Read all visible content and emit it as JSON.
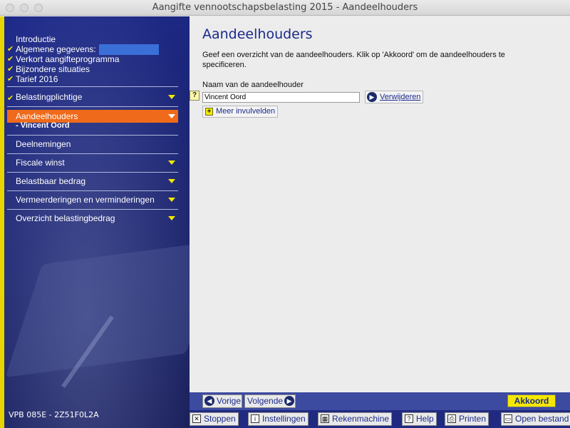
{
  "window": {
    "title": "Aangifte vennootschapsbelasting 2015 - Aandeelhouders"
  },
  "sidebar": {
    "intro_items": [
      {
        "label": "Introductie",
        "checked": false
      },
      {
        "label": "Algemene gegevens:",
        "checked": true
      },
      {
        "label": "Verkort aangifteprogramma",
        "checked": true
      },
      {
        "label": "Bijzondere situaties",
        "checked": true
      },
      {
        "label": "Tarief 2016",
        "checked": true
      }
    ],
    "items": [
      {
        "label": "Belastingplichtige",
        "checked": true
      },
      {
        "label": "Aandeelhouders",
        "active": true,
        "sub": "- Vincent Oord"
      },
      {
        "label": "Deelnemingen"
      },
      {
        "label": "Fiscale winst"
      },
      {
        "label": "Belastbaar bedrag"
      },
      {
        "label": "Vermeerderingen en verminderingen"
      },
      {
        "label": "Overzicht belastingbedrag"
      }
    ],
    "version": "VPB 085E - 2Z51F0L2A"
  },
  "main": {
    "title": "Aandeelhouders",
    "description": "Geef een overzicht van de aandeelhouders. Klik op 'Akkoord' om de aandeelhouders te specificeren.",
    "field_label": "Naam van de aandeelhouder",
    "field_value": "Vincent Oord",
    "help_label": "?",
    "remove_label": "Verwijderen",
    "more_label": "Meer invulvelden"
  },
  "navigation": {
    "prev_label": "Vorige",
    "next_label": "Volgende",
    "accept_label": "Akkoord"
  },
  "toolbar": {
    "stop_label": "Stoppen",
    "settings_label": "Instellingen",
    "calculator_label": "Rekenmachine",
    "help_label": "Help",
    "print_label": "Printen",
    "open_label": "Open bestand"
  },
  "colors": {
    "sidebar_blue": "#1e2a8a",
    "active_orange": "#ef6a1a",
    "accent_yellow": "#f4e800",
    "title_blue": "#1a2a8a"
  }
}
